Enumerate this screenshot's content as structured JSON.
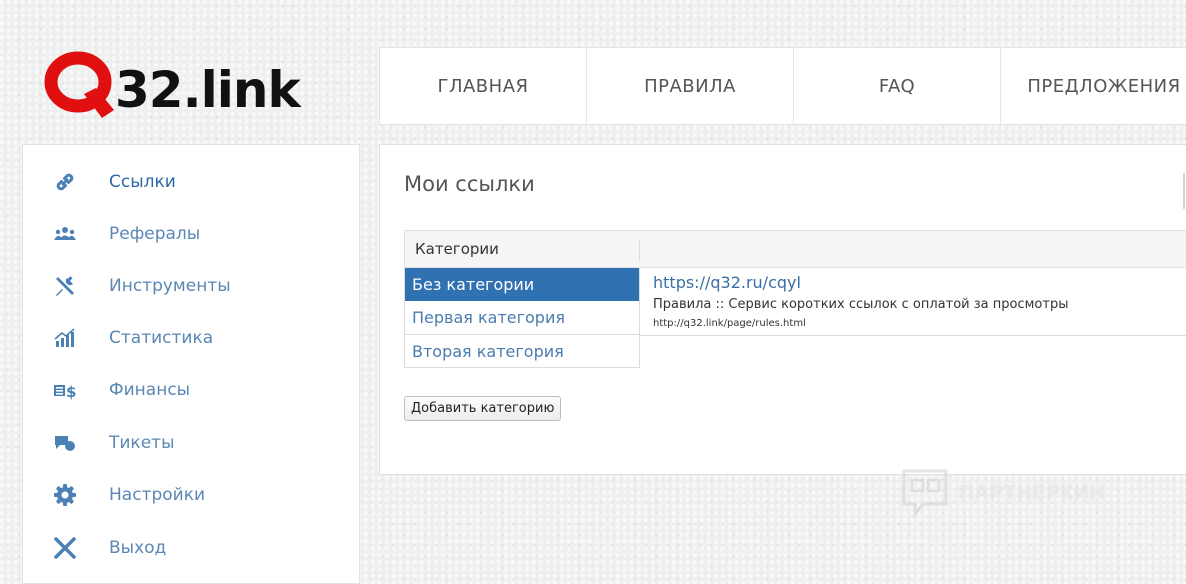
{
  "logo": {
    "text": "32.link"
  },
  "nav": {
    "items": [
      {
        "label": "ГЛАВНАЯ"
      },
      {
        "label": "ПРАВИЛА"
      },
      {
        "label": "FAQ"
      },
      {
        "label": "ПРЕДЛОЖЕНИЯ"
      }
    ]
  },
  "sidebar": {
    "items": [
      {
        "label": "Ссылки",
        "icon": "link-icon"
      },
      {
        "label": "Рефералы",
        "icon": "users-icon"
      },
      {
        "label": "Инструменты",
        "icon": "tools-icon"
      },
      {
        "label": "Статистика",
        "icon": "chart-icon"
      },
      {
        "label": "Финансы",
        "icon": "money-icon"
      },
      {
        "label": "Тикеты",
        "icon": "chat-icon"
      },
      {
        "label": "Настройки",
        "icon": "gear-icon"
      },
      {
        "label": "Выход",
        "icon": "close-icon"
      }
    ]
  },
  "main": {
    "title": "Мои ссылки",
    "categories_header": "Категории",
    "categories": [
      {
        "label": "Без категории",
        "selected": true
      },
      {
        "label": "Первая категория"
      },
      {
        "label": "Вторая категория"
      }
    ],
    "link": {
      "url": "https://q32.ru/cqyl",
      "title": "Правила :: Сервис коротких ссылок с оплатой за просмотры",
      "source": "http://q32.link/page/rules.html"
    },
    "add_category_label": "Добавить категорию"
  },
  "watermark": {
    "text": "ПАРТНЕРКИН"
  },
  "colors": {
    "accent": "#3071b2",
    "link": "#5a87b4",
    "logo_red": "#e01010"
  }
}
